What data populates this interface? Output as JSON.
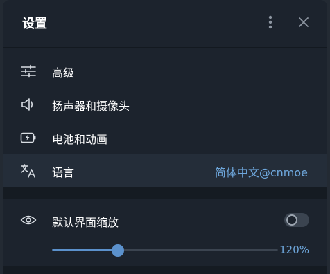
{
  "header": {
    "title": "设置",
    "menu_icon": "vertical-dots-icon",
    "close_icon": "close-icon"
  },
  "rows": [
    {
      "icon": "sliders-icon",
      "label": "高级"
    },
    {
      "icon": "speaker-icon",
      "label": "扬声器和摄像头"
    },
    {
      "icon": "battery-icon",
      "label": "电池和动画"
    },
    {
      "icon": "translate-icon",
      "label": "语言",
      "value": "简体中文@cnmoe"
    }
  ],
  "zoom": {
    "icon": "eye-icon",
    "label": "默认界面缩放",
    "toggle_on": false,
    "slider_fraction": 0.29,
    "value": "120%"
  },
  "colors": {
    "accent": "#5b91cc",
    "accent_text": "#6ea7dc",
    "panel": "#1c232d"
  }
}
